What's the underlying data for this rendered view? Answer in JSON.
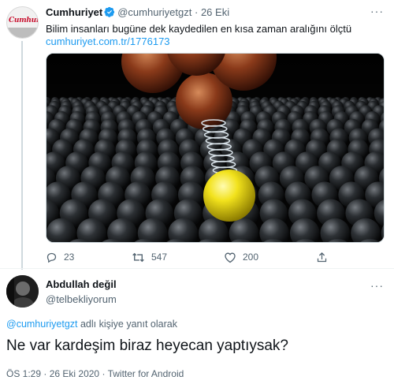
{
  "tweet": {
    "author_name": "Cumhuriyet",
    "author_handle": "@cumhuriyetgzt",
    "separator": "·",
    "date": "26 Eki",
    "text": "Bilim insanları bugüne dek kaydedilen en kısa zaman aralığını ölçtü",
    "link": "cumhuriyet.com.tr/1776173",
    "more_label": "···",
    "avatar_logo_text": "Cumhuriyet",
    "actions": {
      "reply_count": "23",
      "retweet_count": "547",
      "like_count": "200"
    }
  },
  "reply": {
    "author_name": "Abdullah değil",
    "author_handle": "@telbekliyorum",
    "more_label": "···",
    "reply_to_mention": "@cumhuriyetgzt",
    "reply_to_suffix": " adlı kişiye yanıt olarak",
    "text": "Ne var kardeşim biraz heyecan yaptıysak?",
    "time": "ÖS 1:29",
    "separator1": "·",
    "date": "26 Eki 2020",
    "separator2": "·",
    "source": "Twitter for Android"
  },
  "colors": {
    "link": "#1d9bf0",
    "secondary_text": "#536471",
    "primary_text": "#0f1419",
    "verified": "#1d9bf0",
    "divider": "#eff3f4"
  },
  "icons": {
    "verified": "verified-badge-icon",
    "reply": "reply-icon",
    "retweet": "retweet-icon",
    "like": "heart-icon",
    "share": "share-icon",
    "more": "more-icon"
  }
}
